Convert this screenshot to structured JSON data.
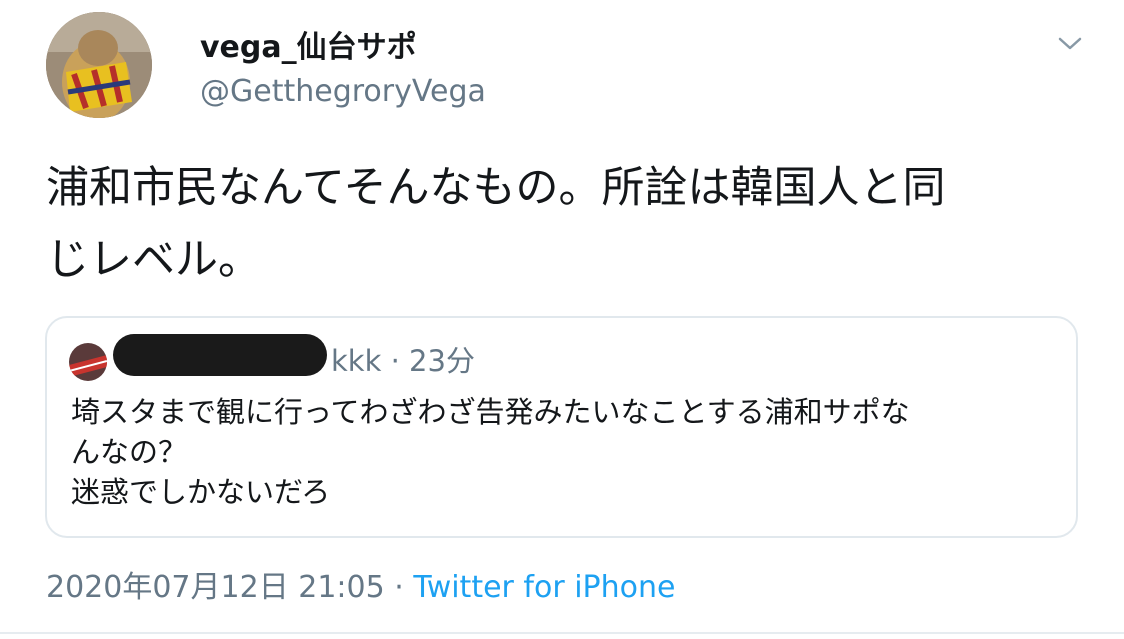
{
  "author": {
    "display_name": "vega_仙台サポ",
    "handle": "@GetthegroryVega"
  },
  "tweet": {
    "text_lines": [
      "浦和市民なんてそんなもの。所詮は韓国人と同",
      "じレベル。"
    ]
  },
  "quoted": {
    "handle_visible": "kkk",
    "separator": "·",
    "time": "23分",
    "text_lines": [
      "埼スタまで観に行ってわざわざ告発みたいなことする浦和サポな",
      "んなの？",
      "迷惑でしかないだろ"
    ]
  },
  "meta": {
    "timestamp": "2020年07月12日 21:05",
    "separator": "·",
    "source": "Twitter for iPhone"
  },
  "icons": {
    "menu": "chevron-down-icon"
  },
  "colors": {
    "text_primary": "#14171a",
    "text_secondary": "#657786",
    "link": "#1da1f2",
    "border": "#e1e8ed",
    "redaction": "#1a1a1a"
  }
}
